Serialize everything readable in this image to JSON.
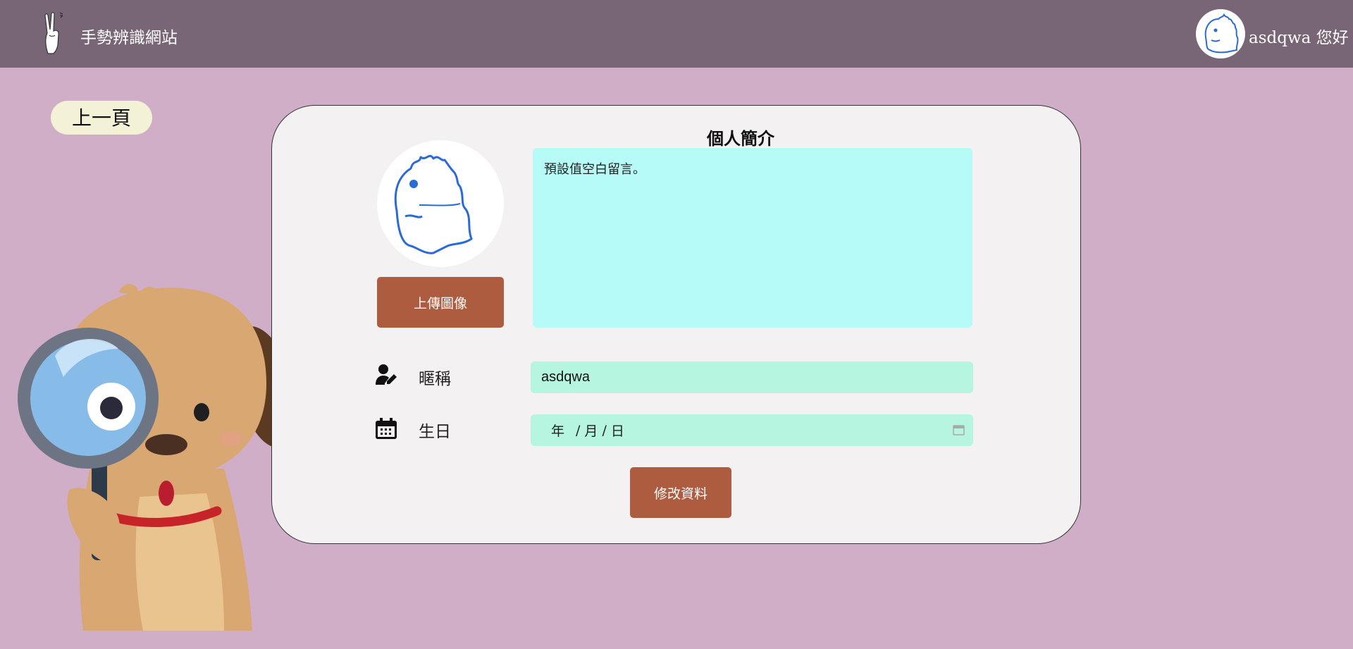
{
  "header": {
    "site_title": "手勢辨識網站",
    "username": "asdqwa",
    "greeting_suffix": "您好",
    "greeting": "asdqwa 您好"
  },
  "back_button": {
    "label": "上一頁"
  },
  "profile": {
    "heading": "個人簡介",
    "upload_button": "上傳圖像",
    "bio": "預設值空白留言。",
    "nickname_label": "暱稱",
    "nickname_value": "asdqwa",
    "birthday_label": "生日",
    "birthday_placeholder": {
      "year": "年",
      "month": "月",
      "day": "日",
      "sep": "/"
    },
    "submit_button": "修改資料"
  },
  "icons": {
    "logo": "hand-gesture-icon",
    "nickname": "user-edit-icon",
    "birthday": "calendar-icon",
    "date_picker": "calendar-mini-icon"
  },
  "colors": {
    "header_bg": "#786575",
    "page_bg": "#d0aec8",
    "card_bg": "#f3f1f2",
    "button": "#ad5c3f",
    "bio_bg": "#b6fbf8",
    "field_bg": "#b6f5e0",
    "back_button_bg": "#f3f1d6"
  }
}
